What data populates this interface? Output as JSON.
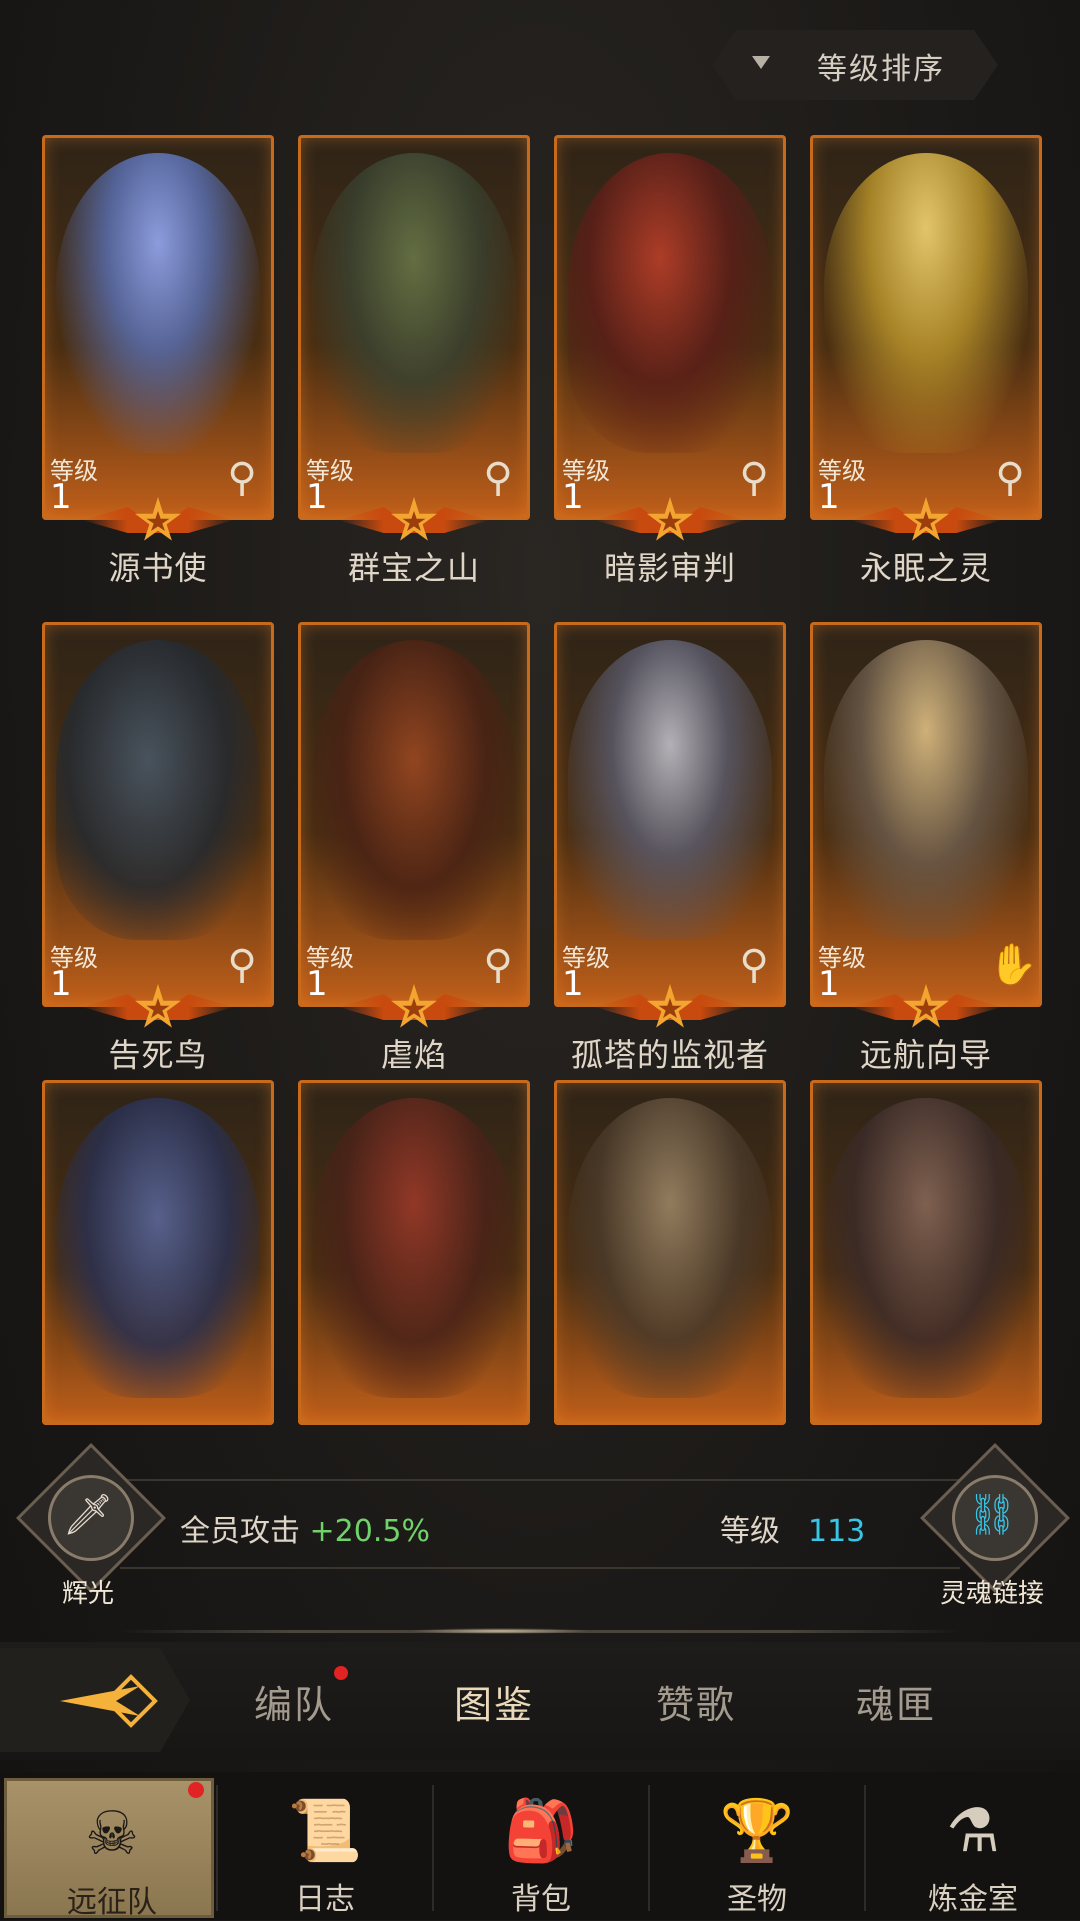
{
  "sort": {
    "label": "等级排序",
    "icon": "dropdown-triangle"
  },
  "heroes": [
    {
      "name": "源书使",
      "level_label": "等级",
      "level": "1",
      "role_icon": "wand-icon",
      "color": "#6a7fb8"
    },
    {
      "name": "群宝之山",
      "level_label": "等级",
      "level": "1",
      "role_icon": "wand-icon",
      "color": "#4a5a3a"
    },
    {
      "name": "暗影审判",
      "level_label": "等级",
      "level": "1",
      "role_icon": "wand-icon",
      "color": "#7a2a22"
    },
    {
      "name": "永眠之灵",
      "level_label": "等级",
      "level": "1",
      "role_icon": "wand-icon",
      "color": "#b89a3a"
    },
    {
      "name": "告死鸟",
      "level_label": "等级",
      "level": "1",
      "role_icon": "wand-icon",
      "color": "#3a4a5a"
    },
    {
      "name": "虐焰",
      "level_label": "等级",
      "level": "1",
      "role_icon": "wand-icon",
      "color": "#7a3a1a"
    },
    {
      "name": "孤塔的监视者",
      "level_label": "等级",
      "level": "1",
      "role_icon": "wand-icon",
      "color": "#5a5a6a"
    },
    {
      "name": "远航向导",
      "level_label": "等级",
      "level": "1",
      "role_icon": "hand-icon",
      "color": "#6a5a4a"
    }
  ],
  "locked_heroes": [
    {
      "color": "#4a5a8a"
    },
    {
      "color": "#6a3a2a"
    },
    {
      "color": "#5a4a3a"
    },
    {
      "color": "#4a3a3a"
    }
  ],
  "stats": {
    "left_emblem": "辉光",
    "attack_label": "全员攻击",
    "attack_value": "+20.5%",
    "level_label": "等级",
    "level_value": "113",
    "right_emblem": "灵魂链接"
  },
  "tabs": [
    "编队",
    "图鉴",
    "赞歌",
    "魂匣"
  ],
  "active_tab": "图鉴",
  "nav": [
    "远征队",
    "日志",
    "背包",
    "圣物",
    "炼金室"
  ],
  "colors": {
    "accent": "#f4b23a",
    "positive": "#6fd36a",
    "level_value": "#38c6e8",
    "notification": "#e22323"
  }
}
